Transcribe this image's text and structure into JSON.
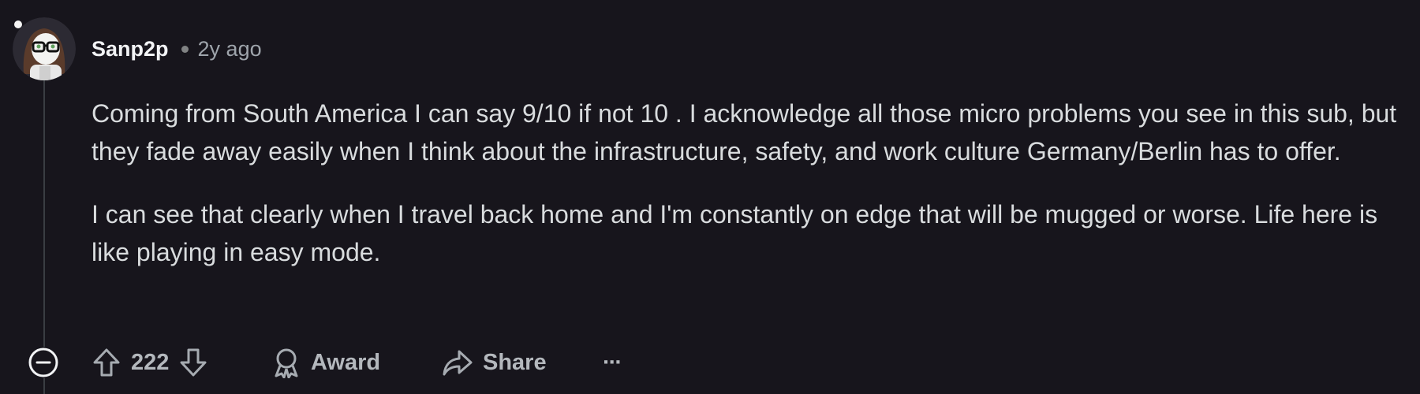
{
  "comment": {
    "username": "Sanp2p",
    "timestamp": "2y ago",
    "paragraphs": [
      "Coming from South America I can say 9/10 if not 10 . I acknowledge all those micro problems you see in this sub, but they fade away easily when I think about the infrastructure, safety, and work culture Germany/Berlin has to offer.",
      "I can see that clearly when I travel back home and I'm constantly on edge that will be mugged or worse. Life here is like playing in easy mode."
    ],
    "vote_count": "222",
    "award_label": "Award",
    "share_label": "Share",
    "more_label": "···"
  },
  "colors": {
    "background": "#17151c",
    "text": "#d9dcde",
    "muted": "#9ea4ab",
    "thread_line": "#3a3d42"
  },
  "icons": {
    "collapse": "minus-circle-icon",
    "upvote": "arrow-up-icon",
    "downvote": "arrow-down-icon",
    "award": "award-icon",
    "share": "share-icon",
    "more": "more-horizontal-icon"
  }
}
